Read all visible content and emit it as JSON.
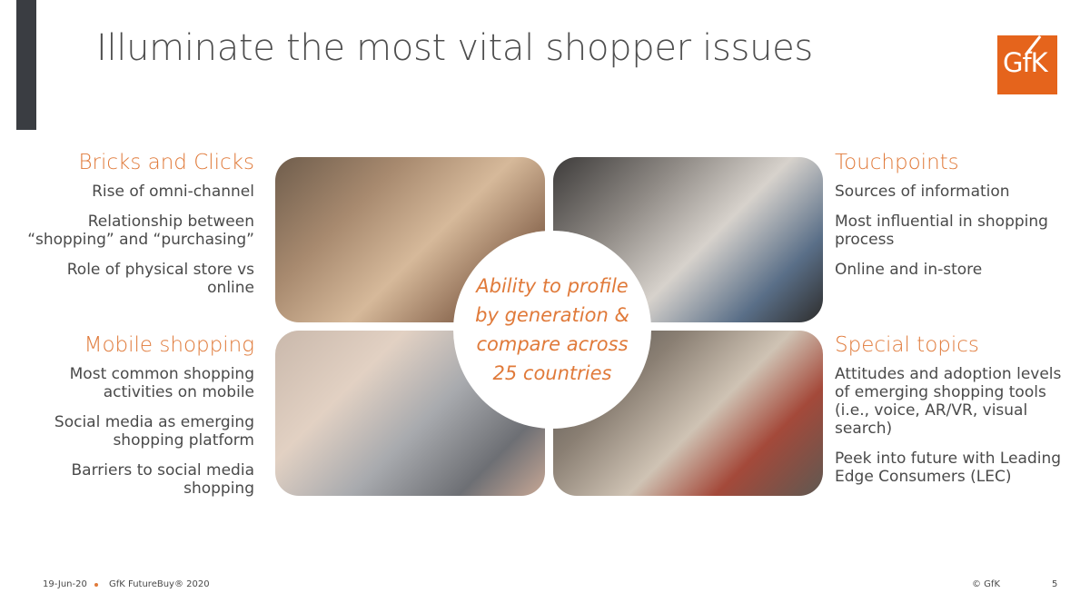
{
  "slide": {
    "title": "Illuminate the most vital shopper issues",
    "logo_text": "GfK"
  },
  "sections": {
    "bricks_and_clicks": {
      "heading": "Bricks and Clicks",
      "items": [
        "Rise of omni-channel",
        "Relationship between “shopping” and “purchasing”",
        "Role of physical store vs online"
      ]
    },
    "mobile_shopping": {
      "heading": "Mobile shopping",
      "items": [
        "Most common shopping activities on mobile",
        "Social media as emerging shopping platform",
        "Barriers to social media shopping"
      ]
    },
    "touchpoints": {
      "heading": "Touchpoints",
      "items": [
        "Sources of information",
        "Most influential in shopping process",
        "Online and in-store"
      ]
    },
    "special_topics": {
      "heading": "Special topics",
      "items": [
        "Attitudes and adoption levels of emerging shopping tools (i.e., voice, AR/VR, visual search)",
        "Peek into future with Leading Edge Consumers (LEC)"
      ]
    }
  },
  "center_callout": "Ability to profile by generation & compare across 25 countries",
  "footer": {
    "date": "19-Jun-20",
    "report": "GfK FutureBuy® 2020",
    "copyright": "© GfK",
    "page_number": "5"
  },
  "colors": {
    "accent": "#e07a3a",
    "logo_bg": "#e5641c",
    "bar": "#3a3d42"
  }
}
